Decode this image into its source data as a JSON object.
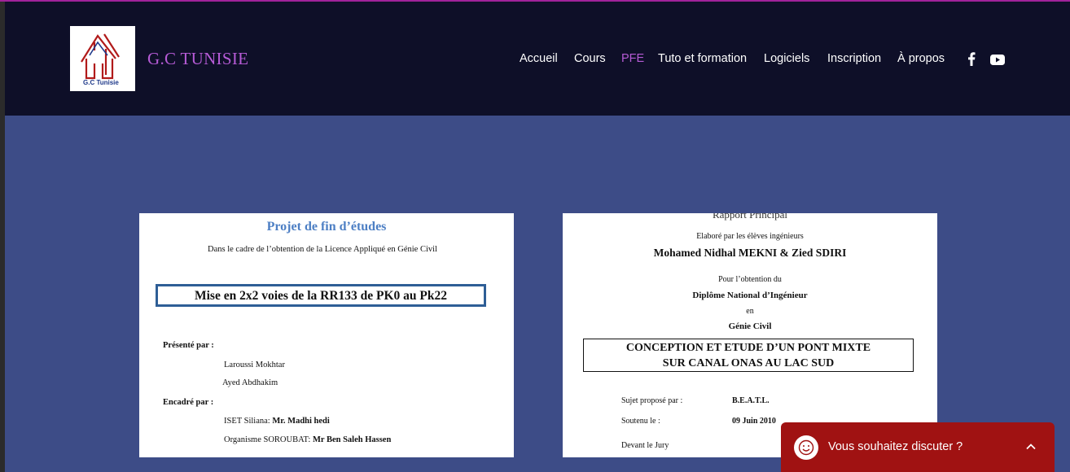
{
  "header": {
    "brand": "G.C TUNISIE",
    "logo_text": "G.C Tunisie",
    "nav": [
      "Accueil",
      "Cours",
      "PFE",
      "Tuto et formation",
      "Logiciels",
      "Inscription",
      "À propos"
    ],
    "active_nav": "PFE",
    "social_icons": [
      "facebook-icon",
      "youtube-icon"
    ]
  },
  "colors": {
    "header_bg": "#0e0f28",
    "page_bg": "#3d4c87",
    "accent": "#b65bd6",
    "chat_bg": "#a01212"
  },
  "cards": [
    {
      "title": "Projet de fin d’études",
      "subtitle": "Dans le cadre de l’obtention de la Licence Appliqué en Génie Civil",
      "boxed_title": "Mise en 2x2 voies de la RR133 de PK0 au Pk22",
      "presented_label": "Présenté par :",
      "authors": [
        "Laroussi Mokhtar",
        "Ayed Abdhakim"
      ],
      "supervised_label": "Encadré par :",
      "supervisors": [
        {
          "org": "ISET Siliana:",
          "name": "Mr. Madhi hedi"
        },
        {
          "org": "Organisme SOROUBAT:",
          "name": "Mr Ben Saleh Hassen"
        }
      ]
    },
    {
      "top_cut": "Rapport Principal",
      "elaborated": "Elaboré par les élèves ingénieurs",
      "authors": "Mohamed Nidhal MEKNI & Zied SDIRI",
      "for": "Pour l’obtention du",
      "diploma": "Diplôme National d’Ingénieur",
      "en": "en",
      "field": "Génie Civil",
      "boxed_title": [
        "CONCEPTION ET ETUDE D’UN PONT MIXTE",
        "SUR CANAL ONAS AU LAC SUD"
      ],
      "rows": [
        {
          "label": "Sujet proposé par :",
          "value": "B.E.A.T.L."
        },
        {
          "label": "Soutenu le :",
          "value": "09 Juin 2010"
        },
        {
          "label": "Devant le Jury",
          "value": ""
        }
      ]
    }
  ],
  "chat": {
    "label": "Vous souhaitez discuter ?"
  }
}
